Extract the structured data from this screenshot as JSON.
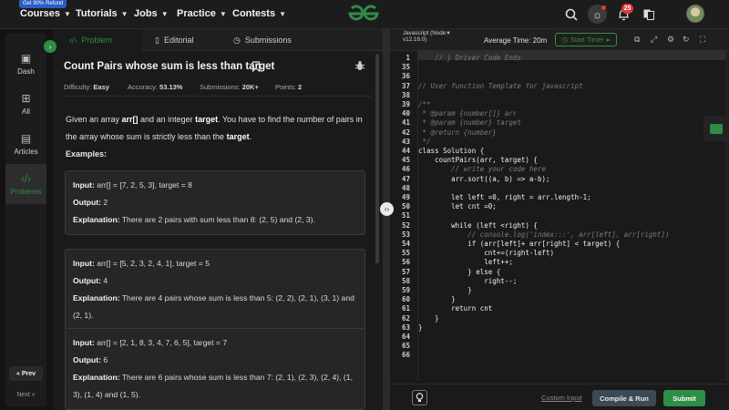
{
  "topnav": {
    "refund_badge": "Get 90% Refund",
    "items": [
      "Courses",
      "Tutorials",
      "Jobs",
      "Practice",
      "Contests"
    ],
    "notification_count": "25",
    "brand_color": "#2f8d46"
  },
  "sidebar": {
    "items": [
      {
        "label": "Dash",
        "icon": "dashboard-icon"
      },
      {
        "label": "All",
        "icon": "grid-icon"
      },
      {
        "label": "Articles",
        "icon": "article-icon"
      },
      {
        "label": "Problems",
        "icon": "code-icon"
      }
    ],
    "prev": "« Prev",
    "next": "Next »"
  },
  "problem": {
    "tabs": [
      {
        "label": "Problem",
        "icon": "code-icon"
      },
      {
        "label": "Editorial",
        "icon": "document-icon"
      },
      {
        "label": "Submissions",
        "icon": "clock-icon"
      }
    ],
    "title": "Count Pairs whose sum is less than target",
    "difficulty_label": "Difficulty:",
    "difficulty": "Easy",
    "accuracy_label": "Accuracy:",
    "accuracy": "53.13%",
    "submissions_label": "Submissions:",
    "submissions": "20K+",
    "points_label": "Points:",
    "points": "2",
    "desc_1": "Given an array ",
    "desc_arr": "arr[]",
    "desc_2": " and an integer ",
    "desc_target": "target",
    "desc_3": ". You have to find the number of pairs in the array whose sum is strictly less than the ",
    "desc_target2": "target",
    "desc_4": ".",
    "examples_heading": "Examples:",
    "input_label": "Input:",
    "output_label": "Output:",
    "explanation_label": "Explanation:",
    "examples": [
      {
        "input": "arr[] = [7, 2, 5, 3], target = 8",
        "output": "2",
        "explanation": "There are 2 pairs with sum less than 8: (2, 5) and (2, 3)."
      },
      {
        "input": "arr[] = [5, 2, 3, 2, 4, 1], target = 5",
        "output": "4",
        "explanation": "There are 4 pairs whose sum is less than 5: (2, 2), (2, 1), (3, 1) and (2, 1)."
      },
      {
        "input": "arr[] = [2, 1, 8, 3, 4, 7, 6, 5], target = 7",
        "output": "6",
        "explanation": "There are 6 pairs whose sum is less than 7: (2, 1), (2, 3), (2, 4), (1, 3), (1, 4) and (1, 5)."
      }
    ]
  },
  "editor": {
    "language": "Javascript (Node v12.19.0)",
    "average_time": "Average Time: 20m",
    "start_timer": "Start Timer",
    "lines": [
      {
        "n": "1",
        "text": "    // } Driver Code Ends",
        "cls": "cm"
      },
      {
        "n": "35",
        "text": "",
        "cls": ""
      },
      {
        "n": "36",
        "text": "",
        "cls": ""
      },
      {
        "n": "37",
        "text": "// User function Template for javascript",
        "cls": "cm"
      },
      {
        "n": "38",
        "text": "",
        "cls": ""
      },
      {
        "n": "39",
        "text": "/**",
        "cls": "cm"
      },
      {
        "n": "40",
        "text": " * @param {number[]} arr",
        "cls": "cm"
      },
      {
        "n": "41",
        "text": " * @param {number} target",
        "cls": "cm"
      },
      {
        "n": "42",
        "text": " * @return {number}",
        "cls": "cm"
      },
      {
        "n": "43",
        "text": " */",
        "cls": "cm"
      },
      {
        "n": "44",
        "text": "class Solution {",
        "cls": ""
      },
      {
        "n": "45",
        "text": "    countPairs(arr, target) {",
        "cls": ""
      },
      {
        "n": "46",
        "text": "        // write your code here",
        "cls": "cm"
      },
      {
        "n": "47",
        "text": "        arr.sort((a, b) => a-b);",
        "cls": ""
      },
      {
        "n": "48",
        "text": "",
        "cls": ""
      },
      {
        "n": "49",
        "text": "        let left =0, right = arr.length-1;",
        "cls": ""
      },
      {
        "n": "50",
        "text": "        let cnt =0;",
        "cls": ""
      },
      {
        "n": "51",
        "text": "",
        "cls": ""
      },
      {
        "n": "52",
        "text": "        while (left <right) {",
        "cls": ""
      },
      {
        "n": "53",
        "text": "            // console.log('index:::', arr[left], arr[right])",
        "cls": "cm"
      },
      {
        "n": "54",
        "text": "            if (arr[left]+ arr[right] < target) {",
        "cls": ""
      },
      {
        "n": "55",
        "text": "                cnt+=(right-left)",
        "cls": ""
      },
      {
        "n": "56",
        "text": "                left++;",
        "cls": ""
      },
      {
        "n": "57",
        "text": "            } else {",
        "cls": ""
      },
      {
        "n": "58",
        "text": "                right--;",
        "cls": ""
      },
      {
        "n": "59",
        "text": "            }",
        "cls": ""
      },
      {
        "n": "60",
        "text": "        }",
        "cls": ""
      },
      {
        "n": "61",
        "text": "        return cnt",
        "cls": ""
      },
      {
        "n": "62",
        "text": "    }",
        "cls": ""
      },
      {
        "n": "63",
        "text": "}",
        "cls": ""
      },
      {
        "n": "64",
        "text": "",
        "cls": ""
      },
      {
        "n": "65",
        "text": "",
        "cls": ""
      },
      {
        "n": "66",
        "text": "",
        "cls": ""
      }
    ],
    "custom_input": "Custom Input",
    "compile_run": "Compile & Run",
    "submit": "Submit"
  }
}
